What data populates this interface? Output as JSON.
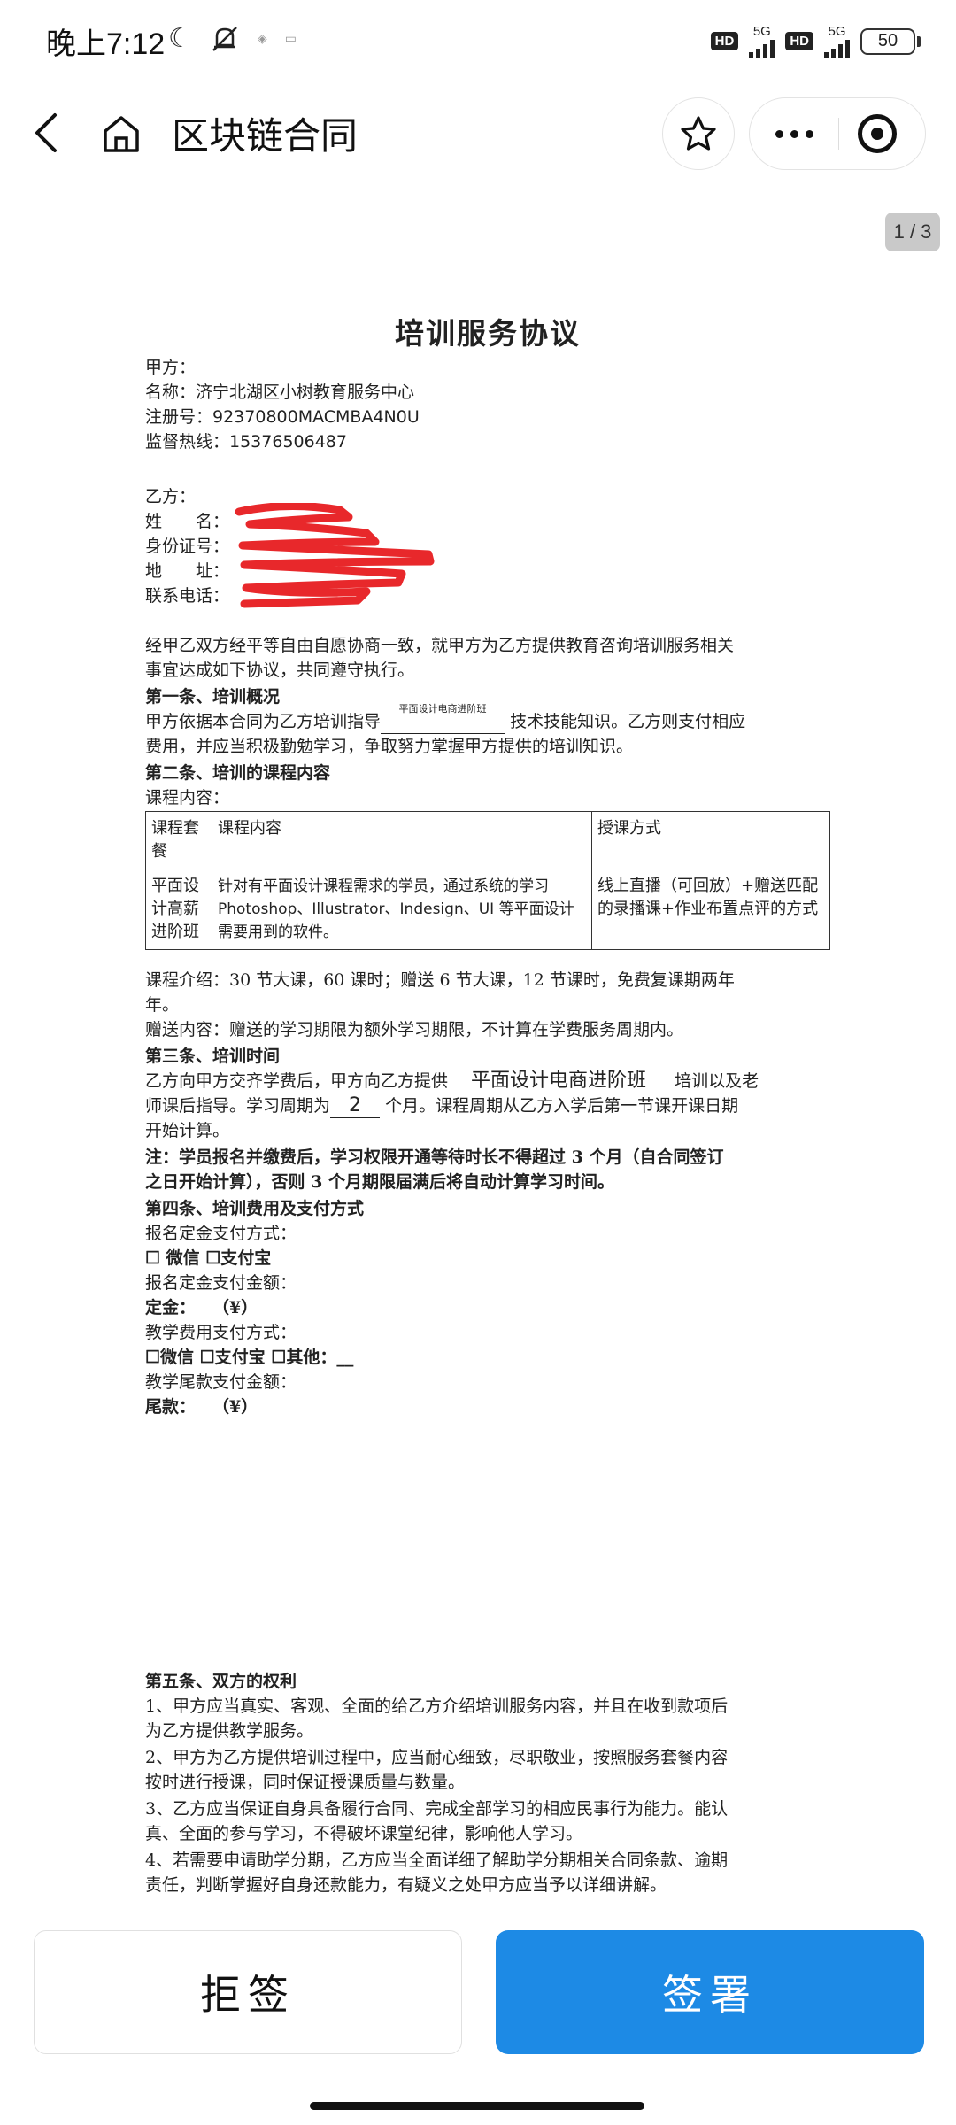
{
  "status_bar": {
    "time": "晚上7:12",
    "icons": [
      "moon-icon",
      "mute-icon",
      "wifi-icon",
      "screen-icon"
    ],
    "hd1": "HD",
    "net1": "5G",
    "hd2": "HD",
    "net2": "5G",
    "battery": "50"
  },
  "nav": {
    "title": "区块链合同",
    "icons": [
      "back-icon",
      "home-icon",
      "star-icon",
      "more-icon",
      "target-icon"
    ]
  },
  "page_indicator": "1 / 3",
  "doc": {
    "title": "培训服务协议",
    "party_a": {
      "label": "甲方：",
      "name": "名称：济宁北湖区小树教育服务中心",
      "reg": "注册号：92370800MACMBA4N0U",
      "hotline": "监督热线：15376506487"
    },
    "party_b": {
      "label": "乙方：",
      "name": "姓　　名：",
      "id": "身份证号：",
      "addr": "地　　址：",
      "phone": "联系电话："
    },
    "intro_1": "经甲乙双方经平等自由自愿协商一致，就甲方为乙方提供教育咨询培训服务相关",
    "intro_2": "事宜达成如下协议，共同遵守执行。",
    "art1_title": "第一条、培训概况",
    "art1_l1_a": "甲方依据本合同为乙方培训指导",
    "art1_l1_fill": "平面设计电商进阶班",
    "art1_l1_b": "技术技能知识。乙方则支付相应",
    "art1_l2": "费用，并应当积极勤勉学习，争取努力掌握甲方提供的培训知识。",
    "art2_title": "第二条、培训的课程内容",
    "art2_label": "课程内容：",
    "table": {
      "headers": [
        "课程套餐",
        "课程内容",
        "授课方式"
      ],
      "row": [
        "平面设计高薪进阶班",
        "针对有平面设计课程需求的学员，通过系统的学习 Photoshop、Illustrator、Indesign、UI 等平面设计需要用到的软件。",
        "线上直播（可回放）+赠送匹配的录播课+作业布置点评的方式"
      ]
    },
    "course_intro_1": "课程介绍：30 节大课，60 课时；赠送 6 节大课，12 节课时，免费复课期两年",
    "course_intro_2": "年。",
    "gift": "赠送内容：赠送的学习期限为额外学习期限，不计算在学费服务周期内。",
    "art3_title": "第三条、培训时间",
    "art3_l1_a": "乙方向甲方交齐学费后，甲方向乙方提供",
    "art3_l1_fill": "平面设计电商进阶班",
    "art3_l1_b": "培训以及老",
    "art3_l2_a": "师课后指导。学习周期为",
    "art3_l2_fill": "2",
    "art3_l2_b": "个月。课程周期从乙方入学后第一节课开课日期",
    "art3_l3": "开始计算。",
    "note_1": "注：学员报名并缴费后，学习权限开通等待时长不得超过 3 个月（自合同签订",
    "note_2": "之日开始计算），否则 3 个月期限届满后将自动计算学习时间。",
    "art4_title": "第四条、培训费用及支付方式",
    "deposit_method": "报名定金支付方式：",
    "deposit_options": "☐ 微信 ☐支付宝",
    "deposit_amount_label": "报名定金支付金额：",
    "deposit": "定金：　　（¥）",
    "tuition_method": "教学费用支付方式：",
    "tuition_options": "☐微信 ☐支付宝 ☐其他：__",
    "balance_label": "教学尾款支付金额：",
    "balance": "尾款：　　（¥）",
    "art5_title": "第五条、双方的权利",
    "art5_1a": "1、甲方应当真实、客观、全面的给乙方介绍培训服务内容，并且在收到款项后",
    "art5_1b": "为乙方提供教学服务。",
    "art5_2a": "2、甲方为乙方提供培训过程中，应当耐心细致，尽职敬业，按照服务套餐内容",
    "art5_2b": "按时进行授课，同时保证授课质量与数量。",
    "art5_3a": "3、乙方应当保证自身具备履行合同、完成全部学习的相应民事行为能力。能认",
    "art5_3b": "真、全面的参与学习，不得破坏课堂纪律，影响他人学习。",
    "art5_4a": "4、若需要申请助学分期，乙方应当全面详细了解助学分期相关合同条款、逾期",
    "art5_4b": "责任，判断掌握好自身还款能力，有疑义之处甲方应当予以详细讲解。"
  },
  "buttons": {
    "reject": "拒签",
    "sign": "签署"
  },
  "colors": {
    "primary": "#1d8ae5",
    "redaction": "#e8282b"
  }
}
